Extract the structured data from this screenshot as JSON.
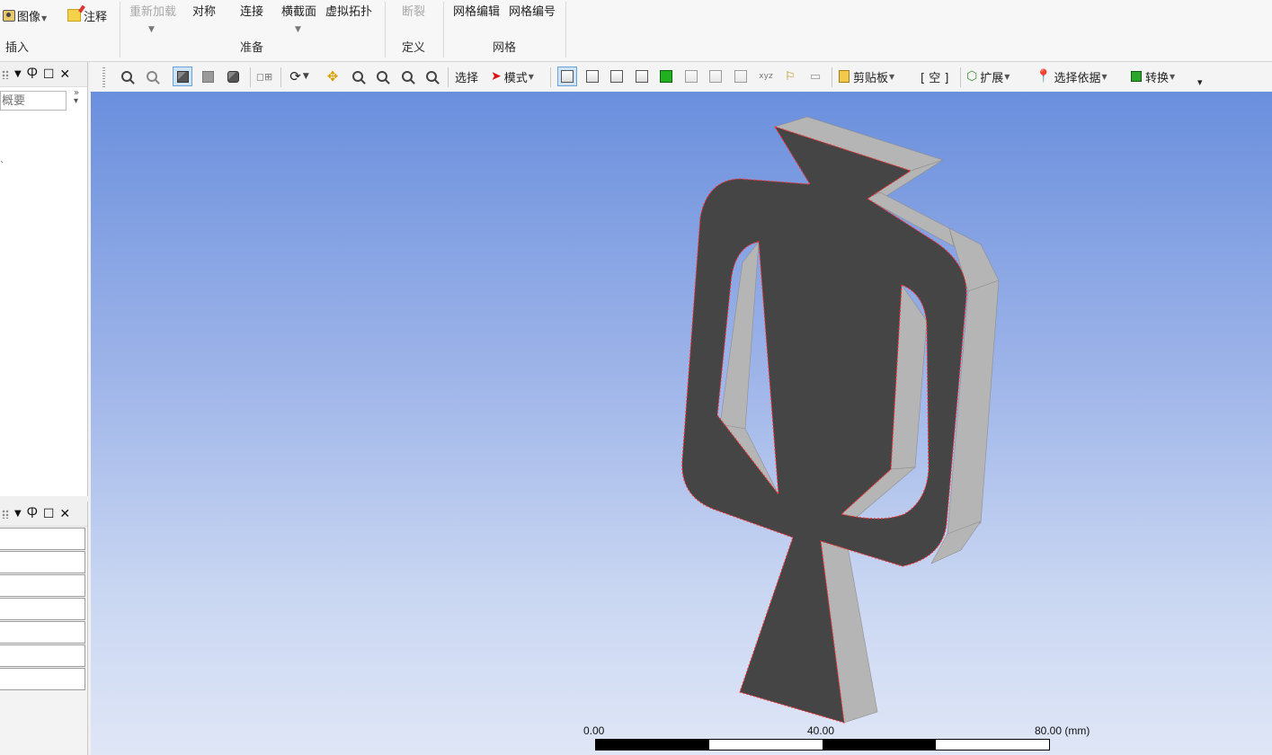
{
  "ribbon": {
    "insert_group": {
      "image_label": "图像",
      "annotation_label": "注释",
      "group_label": "插入"
    },
    "prepare_group": {
      "reload_label": "重新加载",
      "symmetry_label": "对称",
      "connection_label": "连接",
      "cross_section_label": "横截面",
      "virtual_topology_label": "虚拟拓扑",
      "group_label": "准备"
    },
    "define_group": {
      "fracture_label": "断裂",
      "group_label": "定义"
    },
    "mesh_group": {
      "mesh_edit_label": "网格编辑",
      "mesh_numbering_label": "网格编号",
      "group_label": "网格"
    }
  },
  "toolbar": {
    "select_label": "选择",
    "mode_label": "模式",
    "clipboard_label": "剪贴板",
    "empty_label": "[ 空 ]",
    "extend_label": "扩展",
    "select_by_label": "选择依据",
    "convert_label": "转换"
  },
  "outline_panel": {
    "search_placeholder": "概要"
  },
  "viewport": {
    "scale": {
      "label_start": "0.00",
      "label_mid": "40.00",
      "label_end": "80.00 (mm)"
    },
    "model_face_color": "#454545",
    "model_side_color": "#b5b5b5",
    "edge_highlight_color": "#ff2a2a"
  }
}
